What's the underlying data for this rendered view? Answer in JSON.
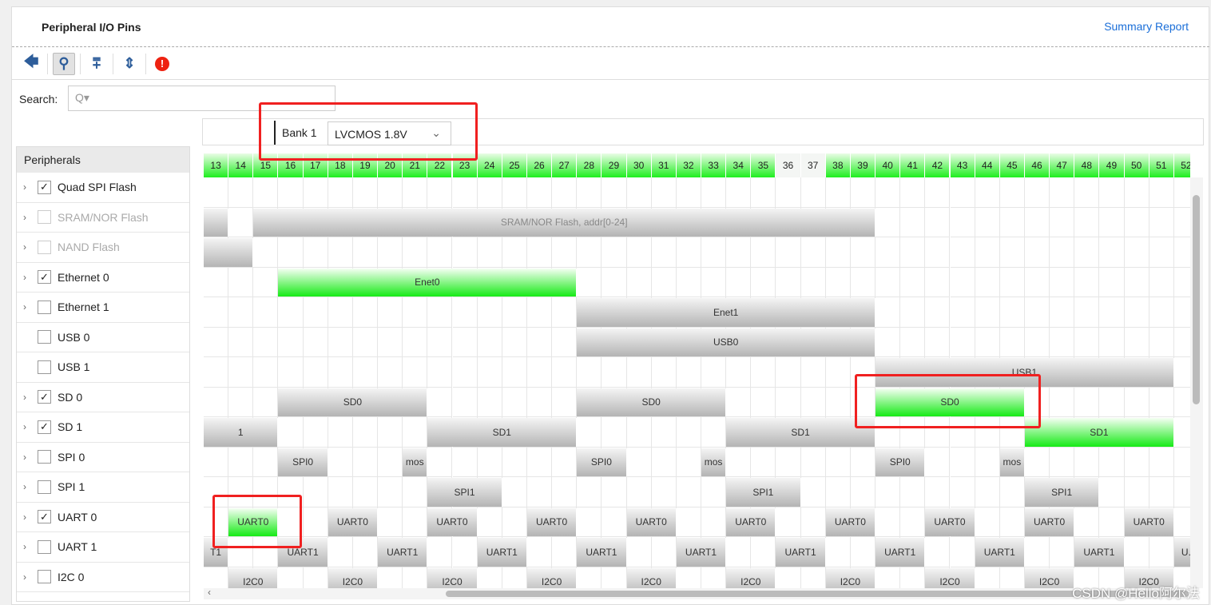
{
  "header": {
    "title": "Peripheral I/O Pins",
    "summary_link": "Summary Report"
  },
  "toolbar": [
    {
      "icon": "back-arrow-icon",
      "glyph": "🡄"
    },
    {
      "icon": "search-icon",
      "glyph": "⚲",
      "active": true
    },
    {
      "icon": "collapse-all-icon",
      "glyph": "⩱"
    },
    {
      "icon": "expand-all-icon",
      "glyph": "⇕"
    },
    {
      "icon": "error-icon",
      "glyph": "!"
    }
  ],
  "search": {
    "label": "Search:",
    "placeholder": "Q▾"
  },
  "bank": {
    "label": "Bank 1",
    "voltage": "LVCMOS 1.8V"
  },
  "peripherals": {
    "header": "Peripherals",
    "items": [
      {
        "label": "Quad SPI Flash",
        "checked": true,
        "expandable": true,
        "enabled": true
      },
      {
        "label": "SRAM/NOR Flash",
        "checked": false,
        "expandable": true,
        "enabled": false
      },
      {
        "label": "NAND Flash",
        "checked": false,
        "expandable": true,
        "enabled": false
      },
      {
        "label": "Ethernet 0",
        "checked": true,
        "expandable": true,
        "enabled": true
      },
      {
        "label": "Ethernet 1",
        "checked": false,
        "expandable": true,
        "enabled": true
      },
      {
        "label": "USB 0",
        "checked": false,
        "expandable": false,
        "enabled": true
      },
      {
        "label": "USB 1",
        "checked": false,
        "expandable": false,
        "enabled": true
      },
      {
        "label": "SD 0",
        "checked": true,
        "expandable": true,
        "enabled": true
      },
      {
        "label": "SD 1",
        "checked": true,
        "expandable": true,
        "enabled": true
      },
      {
        "label": "SPI 0",
        "checked": false,
        "expandable": true,
        "enabled": true
      },
      {
        "label": "SPI 1",
        "checked": false,
        "expandable": true,
        "enabled": true
      },
      {
        "label": "UART 0",
        "checked": true,
        "expandable": true,
        "enabled": true
      },
      {
        "label": "UART 1",
        "checked": false,
        "expandable": true,
        "enabled": true
      },
      {
        "label": "I2C 0",
        "checked": false,
        "expandable": true,
        "enabled": true
      }
    ]
  },
  "pins": {
    "first": 13,
    "last": 52,
    "unassigned": [
      36,
      37
    ]
  },
  "colors": {
    "assigned": "#16ea16",
    "available": "#b4b4b4",
    "highlight": "#f02020"
  },
  "rows": [
    [],
    [
      {
        "label": "",
        "from": 13,
        "to": 13
      },
      {
        "label": "SRAM/NOR Flash, addr[0-24]",
        "from": 15,
        "to": 39,
        "faint": true
      }
    ],
    [
      {
        "label": "",
        "from": 13,
        "to": 14
      }
    ],
    [
      {
        "label": "Enet0",
        "from": 16,
        "to": 27,
        "green": true
      }
    ],
    [
      {
        "label": "Enet1",
        "from": 28,
        "to": 39
      }
    ],
    [
      {
        "label": "USB0",
        "from": 28,
        "to": 39
      }
    ],
    [
      {
        "label": "USB1",
        "from": 40,
        "to": 51
      }
    ],
    [
      {
        "label": "SD0",
        "from": 16,
        "to": 21
      },
      {
        "label": "SD0",
        "from": 28,
        "to": 33
      },
      {
        "label": "SD0",
        "from": 40,
        "to": 45,
        "green": true
      }
    ],
    [
      {
        "label": "1",
        "from": 13,
        "to": 15
      },
      {
        "label": "SD1",
        "from": 22,
        "to": 27
      },
      {
        "label": "SD1",
        "from": 34,
        "to": 39
      },
      {
        "label": "SD1",
        "from": 46,
        "to": 51,
        "green": true
      }
    ],
    [
      {
        "label": "SPI0",
        "from": 16,
        "to": 17
      },
      {
        "label": "mos",
        "from": 21,
        "to": 21
      },
      {
        "label": "SPI0",
        "from": 28,
        "to": 29
      },
      {
        "label": "mos",
        "from": 33,
        "to": 33
      },
      {
        "label": "SPI0",
        "from": 40,
        "to": 41
      },
      {
        "label": "mos",
        "from": 45,
        "to": 45
      }
    ],
    [
      {
        "label": "SPI1",
        "from": 22,
        "to": 24
      },
      {
        "label": "SPI1",
        "from": 34,
        "to": 36
      },
      {
        "label": "SPI1",
        "from": 46,
        "to": 48
      }
    ],
    [
      {
        "label": "UART0",
        "from": 14,
        "to": 15,
        "green": true
      },
      {
        "label": "UART0",
        "from": 18,
        "to": 19
      },
      {
        "label": "UART0",
        "from": 22,
        "to": 23
      },
      {
        "label": "UART0",
        "from": 26,
        "to": 27
      },
      {
        "label": "UART0",
        "from": 30,
        "to": 31
      },
      {
        "label": "UART0",
        "from": 34,
        "to": 35
      },
      {
        "label": "UART0",
        "from": 38,
        "to": 39
      },
      {
        "label": "UART0",
        "from": 42,
        "to": 43
      },
      {
        "label": "UART0",
        "from": 46,
        "to": 47
      },
      {
        "label": "UART0",
        "from": 50,
        "to": 51
      }
    ],
    [
      {
        "label": "T1",
        "from": 13,
        "to": 13
      },
      {
        "label": "UART1",
        "from": 16,
        "to": 17
      },
      {
        "label": "UART1",
        "from": 20,
        "to": 21
      },
      {
        "label": "UART1",
        "from": 24,
        "to": 25
      },
      {
        "label": "UART1",
        "from": 28,
        "to": 29
      },
      {
        "label": "UART1",
        "from": 32,
        "to": 33
      },
      {
        "label": "UART1",
        "from": 36,
        "to": 37
      },
      {
        "label": "UART1",
        "from": 40,
        "to": 41
      },
      {
        "label": "UART1",
        "from": 44,
        "to": 45
      },
      {
        "label": "UART1",
        "from": 48,
        "to": 49
      },
      {
        "label": "U.",
        "from": 52,
        "to": 52
      }
    ],
    [
      {
        "label": "I2C0",
        "from": 14,
        "to": 15
      },
      {
        "label": "I2C0",
        "from": 18,
        "to": 19
      },
      {
        "label": "I2C0",
        "from": 22,
        "to": 23
      },
      {
        "label": "I2C0",
        "from": 26,
        "to": 27
      },
      {
        "label": "I2C0",
        "from": 30,
        "to": 31
      },
      {
        "label": "I2C0",
        "from": 34,
        "to": 35
      },
      {
        "label": "I2C0",
        "from": 38,
        "to": 39
      },
      {
        "label": "I2C0",
        "from": 42,
        "to": 43
      },
      {
        "label": "I2C0",
        "from": 46,
        "to": 47
      },
      {
        "label": "I2C0",
        "from": 50,
        "to": 51
      }
    ]
  ],
  "watermark": "CSDN @Hello阿尔法"
}
